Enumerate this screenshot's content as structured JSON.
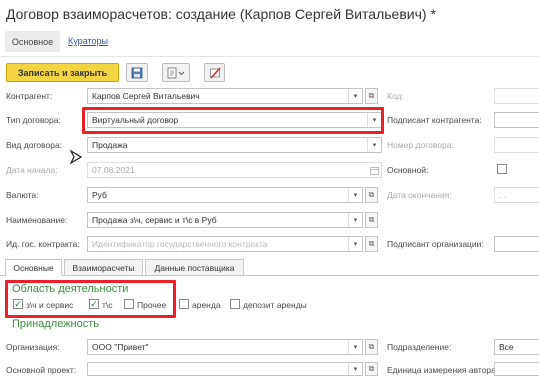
{
  "window": {
    "title": "Договор взаиморасчетов: создание (Карпов Сергей Витальевич) *"
  },
  "nav": {
    "active_tab": "Основное",
    "link_tab": "Кураторы"
  },
  "toolbar": {
    "save_close_label": "Записать и закрыть",
    "save_icon": "floppy-disk-icon",
    "generate_icon": "generate-documents-icon",
    "clear_icon": "clear-icon"
  },
  "form": {
    "kontragent": {
      "label": "Контрагент:",
      "value": "Карпов Сергей Витальевич"
    },
    "kod": {
      "label": "Код:",
      "value": ""
    },
    "tip": {
      "label": "Тип договора:",
      "value": "Виртуальный договор"
    },
    "podpisant_k": {
      "label": "Подписант контрагента:",
      "value": ""
    },
    "vid": {
      "label": "Вид договора:",
      "value": "Продажа"
    },
    "nomer": {
      "label": "Номер договора:",
      "value": ""
    },
    "data_nachala": {
      "label": "Дата начала:",
      "value": "07.08.2021"
    },
    "osnovnoy": {
      "label": "Основной:",
      "checked": false
    },
    "valyuta": {
      "label": "Валюта:",
      "value": "Руб"
    },
    "data_okonch": {
      "label": "Дата окончания:",
      "value": ". ."
    },
    "naimenovanie": {
      "label": "Наименование:",
      "value": "Продажа з\\ч, сервис и т\\с в Руб"
    },
    "ig_kontrakta": {
      "label": "Ид. гос. контракта:",
      "placeholder": "Идентификатор государственного контракта"
    },
    "podpisant_org": {
      "label": "Подписант организации:",
      "value": ""
    }
  },
  "subtabs": [
    "Основные",
    "Взаиморасчеты",
    "Данные поставщика"
  ],
  "oblast": {
    "title": "Область деятельности",
    "items": [
      {
        "label": "з\\ч и сервис",
        "checked": true
      },
      {
        "label": "т\\с",
        "checked": true
      },
      {
        "label": "Прочее",
        "checked": false
      },
      {
        "label": "аренда",
        "checked": false
      },
      {
        "label": "депозит аренды",
        "checked": false
      }
    ]
  },
  "prinadlezhnost": {
    "title": "Принадлежность",
    "organizaciya": {
      "label": "Организация:",
      "value": "ООО \"Привет\""
    },
    "podrazdelenie": {
      "label": "Подразделение:",
      "value": "Все"
    },
    "osnovnoy_proekt": {
      "label": "Основной проект:",
      "value": ""
    },
    "edinica": {
      "label": "Единица измерения автораб:",
      "value": ""
    }
  },
  "colors": {
    "highlight": "#e8212a",
    "accent_yellow": "#f5d442",
    "section_green": "#3d8e3d",
    "link_blue": "#3a55a6"
  }
}
